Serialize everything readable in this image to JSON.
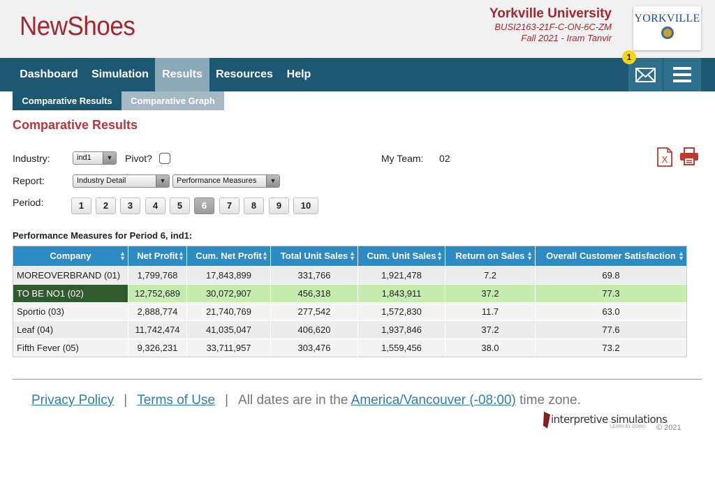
{
  "header": {
    "brand": "NewShoes",
    "university": "Yorkville University",
    "course": "BUSI2163-21F-C-ON-6C-ZM",
    "term": "Fall 2021 - Iram Tanvir",
    "logo_text": "YORKVILLE"
  },
  "nav": {
    "items": [
      {
        "label": "Dashboard"
      },
      {
        "label": "Simulation"
      },
      {
        "label": "Results"
      },
      {
        "label": "Resources"
      },
      {
        "label": "Help"
      }
    ],
    "active": "Results",
    "mail_badge": "1"
  },
  "subtabs": [
    {
      "label": "Comparative Results",
      "active": true
    },
    {
      "label": "Comparative Graph",
      "active": false
    }
  ],
  "page_title": "Comparative Results",
  "filters": {
    "industry_label": "Industry:",
    "industry_value": "ind1",
    "pivot_label": "Pivot?",
    "pivot_checked": false,
    "my_team_label": "My Team:",
    "my_team_value": "02",
    "report_label": "Report:",
    "report_value": "Industry Detail",
    "measure_value": "Performance Measures",
    "period_label": "Period:",
    "periods": [
      "1",
      "2",
      "3",
      "4",
      "5",
      "6",
      "7",
      "8",
      "9",
      "10"
    ],
    "selected_period": "6"
  },
  "table": {
    "caption": "Performance Measures for Period 6, ind1:",
    "columns": [
      "Company",
      "Net Profit",
      "Cum. Net Profit",
      "Total Unit Sales",
      "Cum. Unit Sales",
      "Return on Sales",
      "Overall Customer Satisfaction"
    ],
    "rows": [
      [
        "MOREOVERBRAND (01)",
        "1,799,768",
        "17,843,899",
        "331,766",
        "1,921,478",
        "7.2",
        "69.8"
      ],
      [
        "TO BE NO1 (02)",
        "12,752,689",
        "30,072,907",
        "456,318",
        "1,843,911",
        "37.2",
        "77.3"
      ],
      [
        "Sportio (03)",
        "2,888,774",
        "21,740,769",
        "277,542",
        "1,572,830",
        "11.7",
        "63.0"
      ],
      [
        "Leaf (04)",
        "11,742,474",
        "41,035,047",
        "406,620",
        "1,937,846",
        "37.2",
        "77.6"
      ],
      [
        "Fifth Fever (05)",
        "9,326,231",
        "33,711,957",
        "303,476",
        "1,559,456",
        "38.0",
        "73.2"
      ]
    ],
    "highlighted_row": 1
  },
  "footer": {
    "privacy": "Privacy Policy",
    "separator": "|",
    "terms": "Terms of Use",
    "tz_prefix": "All dates are in the",
    "tz_link": "America/Vancouver (-08:00)",
    "tz_suffix": "time zone.",
    "logo_word": "interpretive simulations",
    "logo_tag": "LEARN BY DOING",
    "copyright": "© 2021"
  },
  "colors": {
    "brand_red": "#a0282e",
    "nav_bg": "#1d5873",
    "table_header": "#2b8bc2",
    "highlight_row": "#c7ecb0",
    "highlight_company": "#2f5b2f",
    "link": "#2e7fae"
  },
  "icons": {
    "mail": "envelope-icon",
    "menu": "hamburger-menu-icon",
    "excel": "excel-export-icon",
    "print": "printer-icon",
    "sort": "sort-arrows-icon"
  }
}
